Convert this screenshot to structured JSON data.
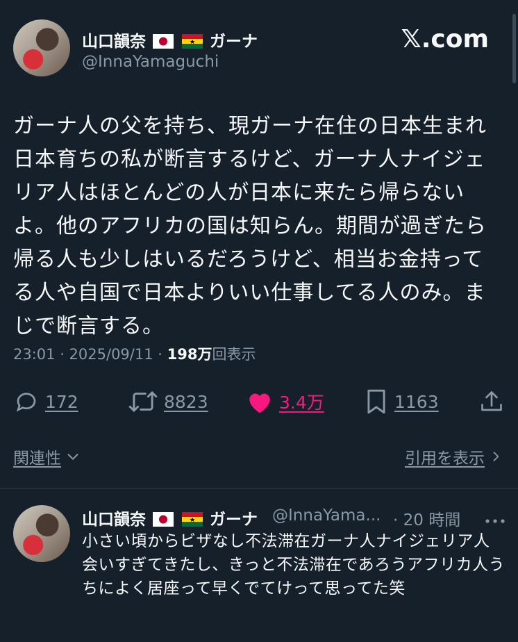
{
  "site": "𝕏.com",
  "tweet": {
    "author_name": "山口韻奈",
    "author_suffix": "ガーナ",
    "handle": "@InnaYamaguchi",
    "text": "ガーナ人の父を持ち、現ガーナ在住の日本生まれ日本育ちの私が断言するけど、ガーナ人ナイジェリア人はほとんどの人が日本に来たら帰らないよ。他のアフリカの国は知らん。期間が過ぎたら帰る人も少しはいるだろうけど、相当お金持ってる人や自国で日本よりいい仕事してる人のみ。まじで断言する。",
    "time": "23:01 · 2025/09/11 · ",
    "views": "198万",
    "views_label": "回表示",
    "replies": "172",
    "retweets": "8823",
    "likes": "3.4万",
    "bookmarks": "1163",
    "related_label": "関連性",
    "quotes_label": "引用を表示"
  },
  "reply": {
    "author_name": "山口韻奈",
    "author_suffix": "ガーナ",
    "handle": "@InnaYama...",
    "time": "· 20 時間",
    "text": "小さい頃からビザなし不法滞在ガーナ人ナイジェリア人会いすぎてきたし、きっと不法滞在であろうアフリカ人うちによく居座って早くでてけって思ってた笑"
  },
  "colors": {
    "background": "#15202b",
    "secondary": "#8b98a5",
    "like": "#f91880"
  }
}
